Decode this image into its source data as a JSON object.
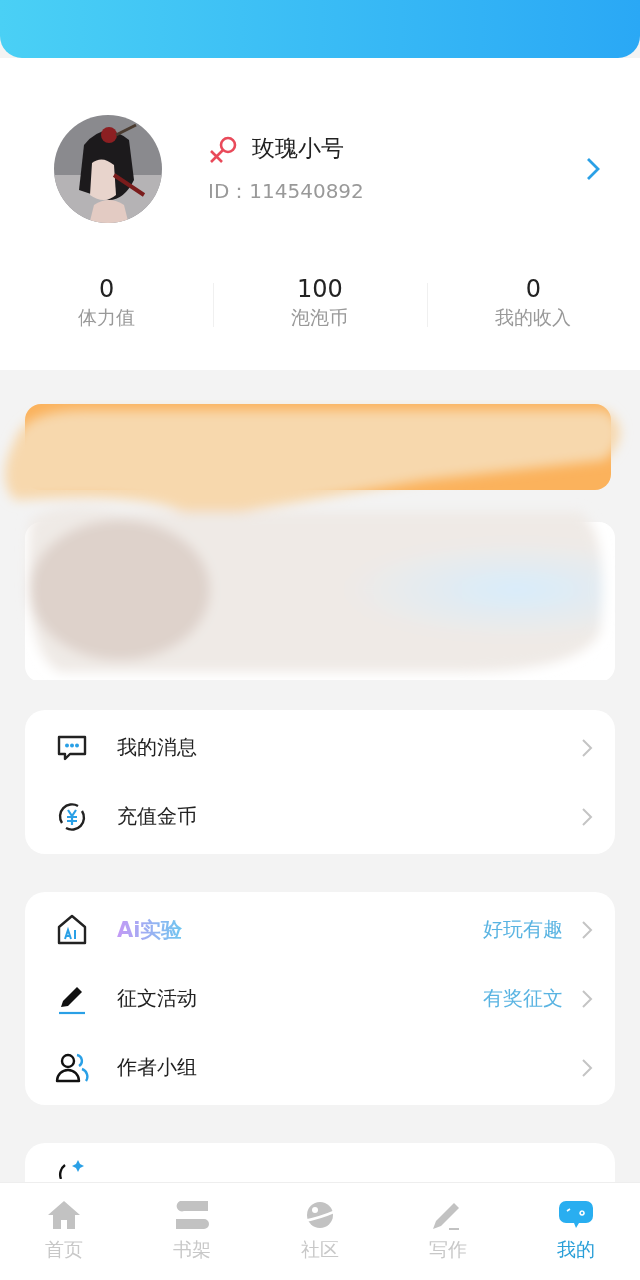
{
  "profile": {
    "name": "玫瑰小号",
    "id": "ID：114540892"
  },
  "stats": [
    {
      "value": "0",
      "label": "体力值"
    },
    {
      "value": "100",
      "label": "泡泡币"
    },
    {
      "value": "0",
      "label": "我的收入"
    }
  ],
  "menu_groups": [
    [
      {
        "kind": "plain",
        "label": "我的消息"
      },
      {
        "kind": "plain",
        "label": "充值金币"
      }
    ],
    [
      {
        "kind": "gradient",
        "label": "Ai实验",
        "hint": "好玩有趣"
      },
      {
        "kind": "plain",
        "label": "征文活动",
        "hint": "有奖征文"
      },
      {
        "kind": "plain",
        "label": "作者小组"
      }
    ]
  ],
  "tabs": [
    {
      "label": "首页",
      "selected": false
    },
    {
      "label": "书架",
      "selected": false
    },
    {
      "label": "社区",
      "selected": false
    },
    {
      "label": "写作",
      "selected": false
    },
    {
      "label": "我的",
      "selected": true
    }
  ]
}
